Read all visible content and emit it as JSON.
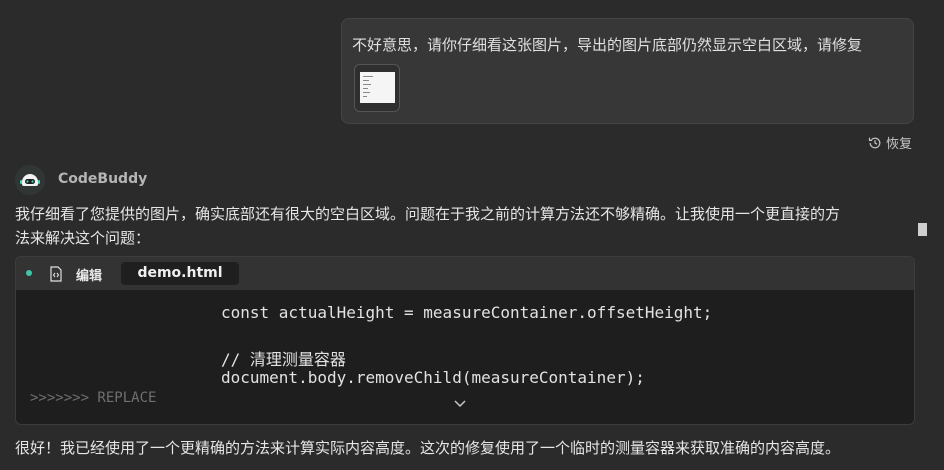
{
  "user_message": {
    "text": "不好意思，请你仔细看这张图片，导出的图片底部仍然显示空白区域，请修复",
    "attachment_icon": "image-thumbnail"
  },
  "restore_label": "恢复",
  "assistant": {
    "name": "CodeBuddy",
    "avatar_icon": "robot-icon",
    "answer_line1": "我仔细看了您提供的图片，确实底部还有很大的空白区域。问题在于我之前的计算方法还不够精确。让我使用一个更直接的方",
    "answer_line2": "法来解决这个问题："
  },
  "code_block": {
    "status_color": "#3fc6a8",
    "action_label": "编辑",
    "file_name": "demo.html",
    "lines": [
      "const actualHeight = measureContainer.offsetHeight;",
      "// 清理测量容器",
      "document.body.removeChild(measureContainer);"
    ],
    "replace_marker": ">>>>>>> REPLACE",
    "expand_icon": "chevron-down-icon"
  },
  "final_message": "很好！我已经使用了一个更精确的方法来计算实际内容高度。这次的修复使用了一个临时的测量容器来获取准确的内容高度。"
}
